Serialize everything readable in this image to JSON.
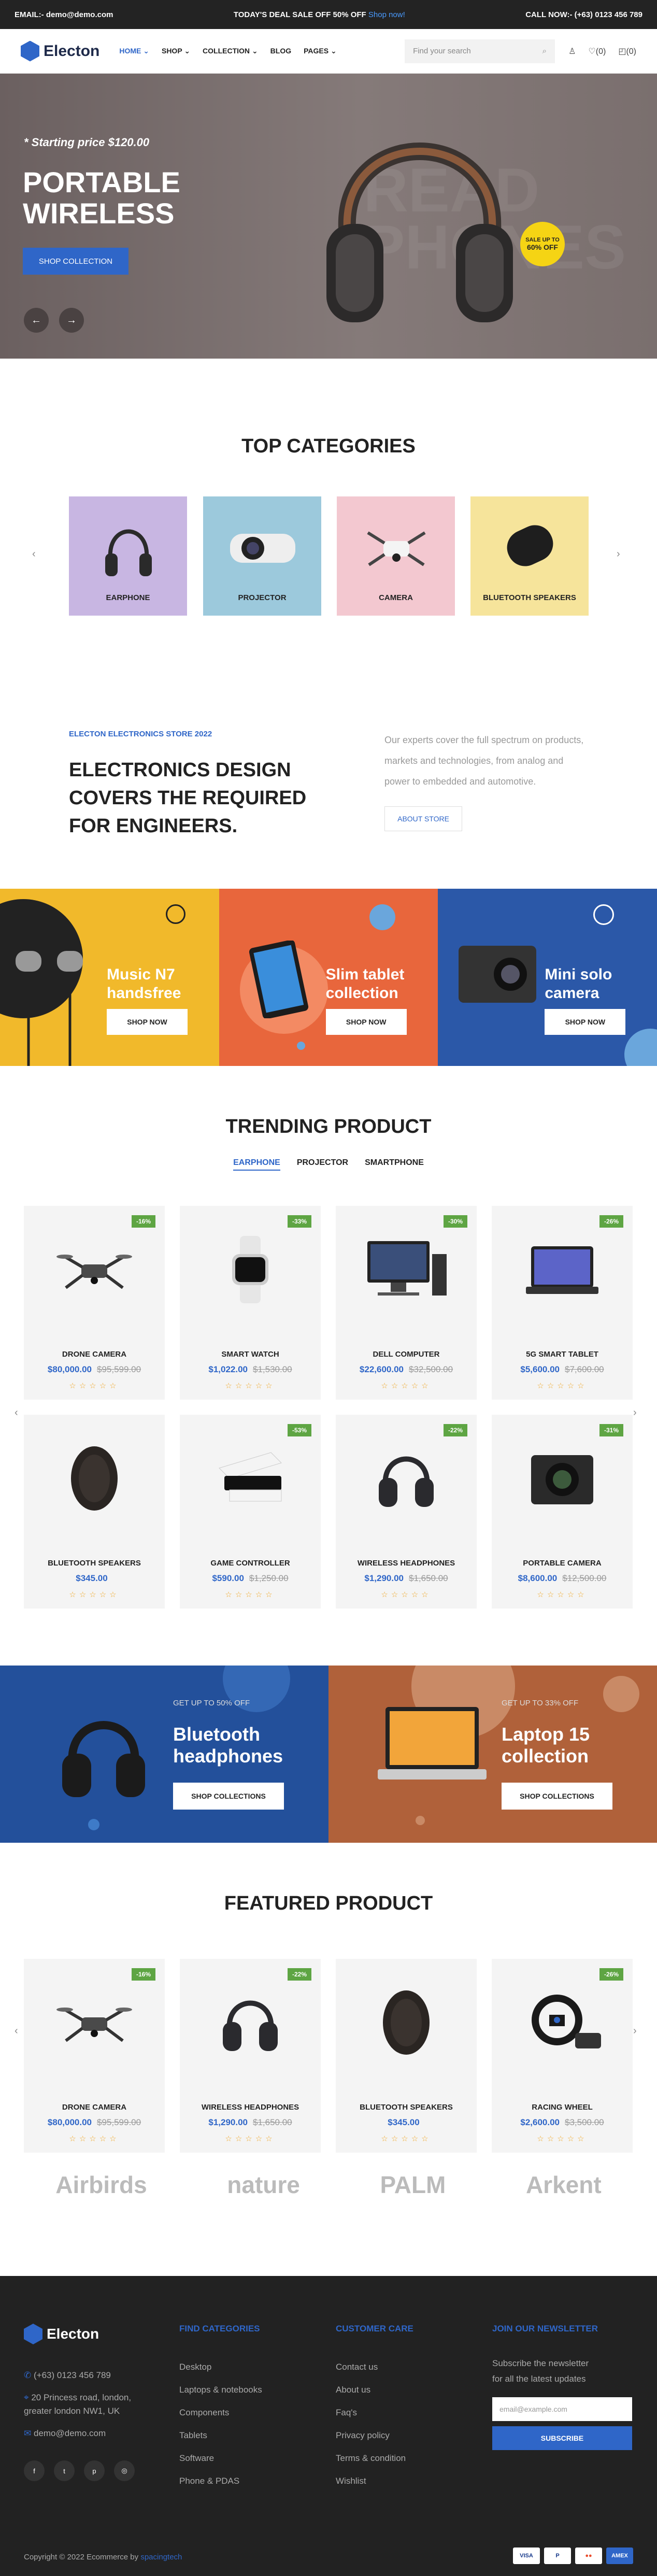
{
  "topbar": {
    "email": "EMAIL:- demo@demo.com",
    "deal": "TODAY'S DEAL SALE OFF 50% OFF",
    "deal_link": "Shop now!",
    "call": "CALL NOW:- (+63) 0123 456 789"
  },
  "header": {
    "logo": "Electon",
    "nav": [
      {
        "label": "HOME",
        "arrow": "⌄"
      },
      {
        "label": "SHOP",
        "arrow": "⌄"
      },
      {
        "label": "COLLECTION",
        "arrow": "⌄"
      },
      {
        "label": "BLOG",
        "arrow": ""
      },
      {
        "label": "PAGES",
        "arrow": "⌄"
      }
    ],
    "search_placeholder": "Find your search",
    "wishlist_count": "(0)",
    "cart_count": "(0)"
  },
  "hero": {
    "price_prefix": "* Starting price ",
    "price": "$120.00",
    "title_line1": "PORTABLE",
    "title_line2": "WIRELESS",
    "button": "SHOP COLLECTION",
    "badge_top": "SALE UP TO",
    "badge_value": "60% OFF",
    "bg_text_1": "READ",
    "bg_text_2": "PHONES"
  },
  "categories": {
    "title": "TOP CATEGORIES",
    "items": [
      {
        "label": "EARPHONE",
        "color": "#c8b6e2"
      },
      {
        "label": "PROJECTOR",
        "color": "#9cc9dc"
      },
      {
        "label": "CAMERA",
        "color": "#f3c8d0"
      },
      {
        "label": "BLUETOOTH SPEAKERS",
        "color": "#f6e49b"
      }
    ]
  },
  "about": {
    "tag": "ELECTON ELECTRONICS STORE 2022",
    "heading": "ELECTRONICS DESIGN COVERS THE REQUIRED FOR ENGINEERS.",
    "text": "Our experts cover the full spectrum on products, markets and technologies, from analog and power to embedded and automotive.",
    "button": "ABOUT STORE"
  },
  "promo3": [
    {
      "title": "Music N7 handsfree",
      "button": "SHOP NOW",
      "color": "#f1b92b"
    },
    {
      "title": "Slim tablet collection",
      "button": "SHOP NOW",
      "color": "#e8663c"
    },
    {
      "title": "Mini solo camera",
      "button": "SHOP NOW",
      "color": "#2b58a8"
    }
  ],
  "trending": {
    "title": "TRENDING PRODUCT",
    "tabs": [
      "EARPHONE",
      "PROJECTOR",
      "SMARTPHONE"
    ],
    "products": [
      {
        "name": "DRONE CAMERA",
        "price": "$80,000.00",
        "old": "$95,599.00",
        "discount": "-16%",
        "icon": "drone-icon"
      },
      {
        "name": "SMART WATCH",
        "price": "$1,022.00",
        "old": "$1,530.00",
        "discount": "-33%",
        "icon": "watch-icon"
      },
      {
        "name": "DELL COMPUTER",
        "price": "$22,600.00",
        "old": "$32,500.00",
        "discount": "-30%",
        "icon": "computer-icon"
      },
      {
        "name": "5G SMART TABLET",
        "price": "$5,600.00",
        "old": "$7,600.00",
        "discount": "-26%",
        "icon": "tablet-icon"
      },
      {
        "name": "BLUETOOTH SPEAKERS",
        "price": "$345.00",
        "old": "",
        "discount": "",
        "icon": "speaker-icon"
      },
      {
        "name": "GAME CONTROLLER",
        "price": "$590.00",
        "old": "$1,250.00",
        "discount": "-53%",
        "icon": "console-icon"
      },
      {
        "name": "WIRELESS HEADPHONES",
        "price": "$1,290.00",
        "old": "$1,650.00",
        "discount": "-22%",
        "icon": "headphones-icon"
      },
      {
        "name": "PORTABLE CAMERA",
        "price": "$8,600.00",
        "old": "$12,500.00",
        "discount": "-31%",
        "icon": "camera-icon"
      }
    ]
  },
  "promo2": [
    {
      "offer": "GET UP TO 50% OFF",
      "title": "Bluetooth headphones",
      "button": "SHOP COLLECTIONS",
      "color": "#23509b"
    },
    {
      "offer": "GET UP TO 33% OFF",
      "title": "Laptop 15 collection",
      "button": "SHOP COLLECTIONS",
      "color": "#b0613a"
    }
  ],
  "featured": {
    "title": "FEATURED PRODUCT",
    "products": [
      {
        "name": "DRONE CAMERA",
        "price": "$80,000.00",
        "old": "$95,599.00",
        "discount": "-16%",
        "icon": "drone-icon"
      },
      {
        "name": "WIRELESS HEADPHONES",
        "price": "$1,290.00",
        "old": "$1,650.00",
        "discount": "-22%",
        "icon": "headphones-icon"
      },
      {
        "name": "BLUETOOTH SPEAKERS",
        "price": "$345.00",
        "old": "",
        "discount": "",
        "icon": "speaker-icon"
      },
      {
        "name": "RACING WHEEL",
        "price": "$2,600.00",
        "old": "$3,500.00",
        "discount": "-26%",
        "icon": "wheel-icon"
      }
    ]
  },
  "brands": [
    "Airbirds",
    "nature",
    "PALM",
    "Arkent"
  ],
  "footer": {
    "logo": "Electon",
    "phone": "(+63) 0123 456 789",
    "address": "20 Princess road, london, greater london NW1, UK",
    "email": "demo@demo.com",
    "social": [
      "f",
      "t",
      "p",
      "◎"
    ],
    "col1": {
      "title": "FIND CATEGORIES",
      "items": [
        "Desktop",
        "Laptops & notebooks",
        "Components",
        "Tablets",
        "Software",
        "Phone & PDAS"
      ]
    },
    "col2": {
      "title": "CUSTOMER CARE",
      "items": [
        "Contact us",
        "About us",
        "Faq's",
        "Privacy policy",
        "Terms & condition",
        "Wishlist"
      ]
    },
    "newsletter": {
      "title": "JOIN OUR NEWSLETTER",
      "text": "Subscribe the newsletter for all the latest updates",
      "placeholder": "email@example.com",
      "button": "SUBSCRIBE"
    },
    "copyright": "Copyright © 2022 Ecommerce by ",
    "copyright_link": "spacingtech",
    "payments": [
      "VISA",
      "P",
      "●●",
      "AMEX"
    ]
  },
  "accent_color": "#2f66c8",
  "discount_color": "#5ea543",
  "star_color": "#f0a726"
}
